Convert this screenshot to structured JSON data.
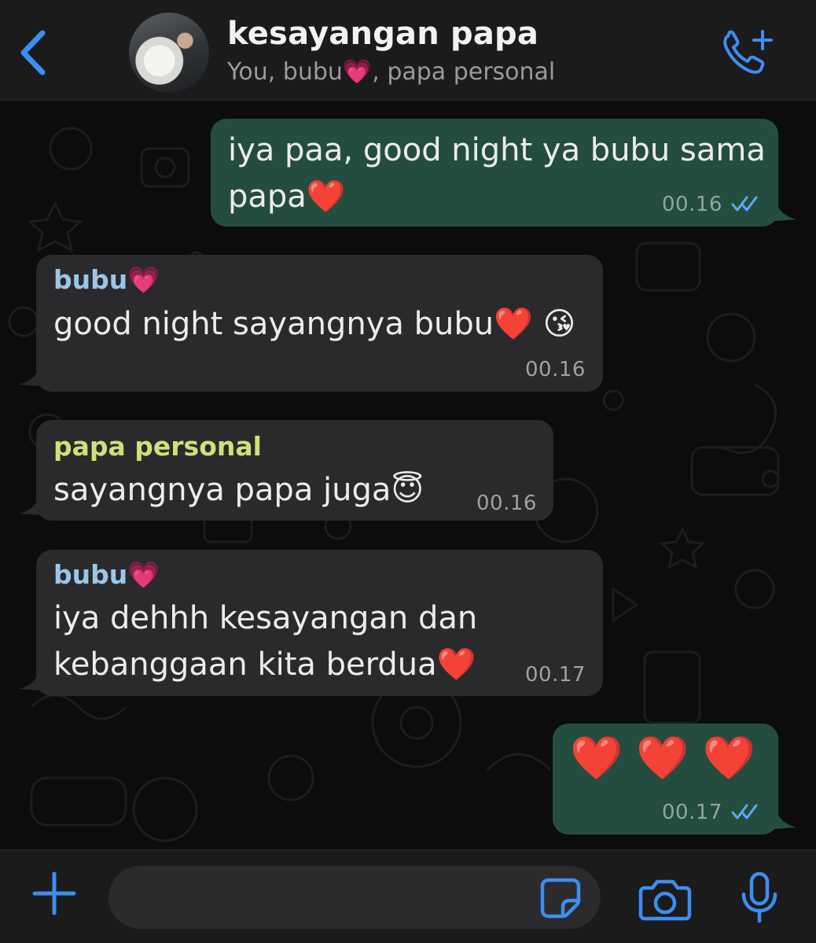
{
  "header": {
    "title": "kesayangan papa",
    "subtitle": "You, bubu💗, papa personal",
    "back_icon": "chevron-left-icon",
    "call_icon": "phone-plus-icon"
  },
  "messages": [
    {
      "direction": "outgoing",
      "lines": [
        "iya paa, good night ya bubu sama",
        "papa❤️"
      ],
      "time": "00.16",
      "status": "read"
    },
    {
      "direction": "incoming",
      "sender": "bubu💗",
      "lines": [
        "good night sayangnya bubu❤️ 😘"
      ],
      "time": "00.16"
    },
    {
      "direction": "incoming",
      "sender": "papa personal",
      "lines": [
        "sayangnya papa juga😇"
      ],
      "time": "00.16"
    },
    {
      "direction": "incoming",
      "sender": "bubu💗",
      "lines": [
        "iya dehhh kesayangan dan",
        "kebanggaan kita berdua❤️"
      ],
      "time": "00.17"
    },
    {
      "direction": "outgoing",
      "lines": [
        "❤️ ❤️ ❤️"
      ],
      "time": "00.17",
      "status": "read"
    }
  ],
  "input_bar": {
    "placeholder": "",
    "icons": [
      "plus-icon",
      "sticker-icon",
      "camera-icon",
      "microphone-icon"
    ]
  },
  "colors": {
    "accent": "#3d8ef0",
    "outgoing_bubble": "#254d3f",
    "incoming_bubble": "#2a2a2c",
    "sender_bubu": "#9cc6e6",
    "sender_papa": "#cfe07a",
    "read_ticks": "#5aa9f5"
  }
}
